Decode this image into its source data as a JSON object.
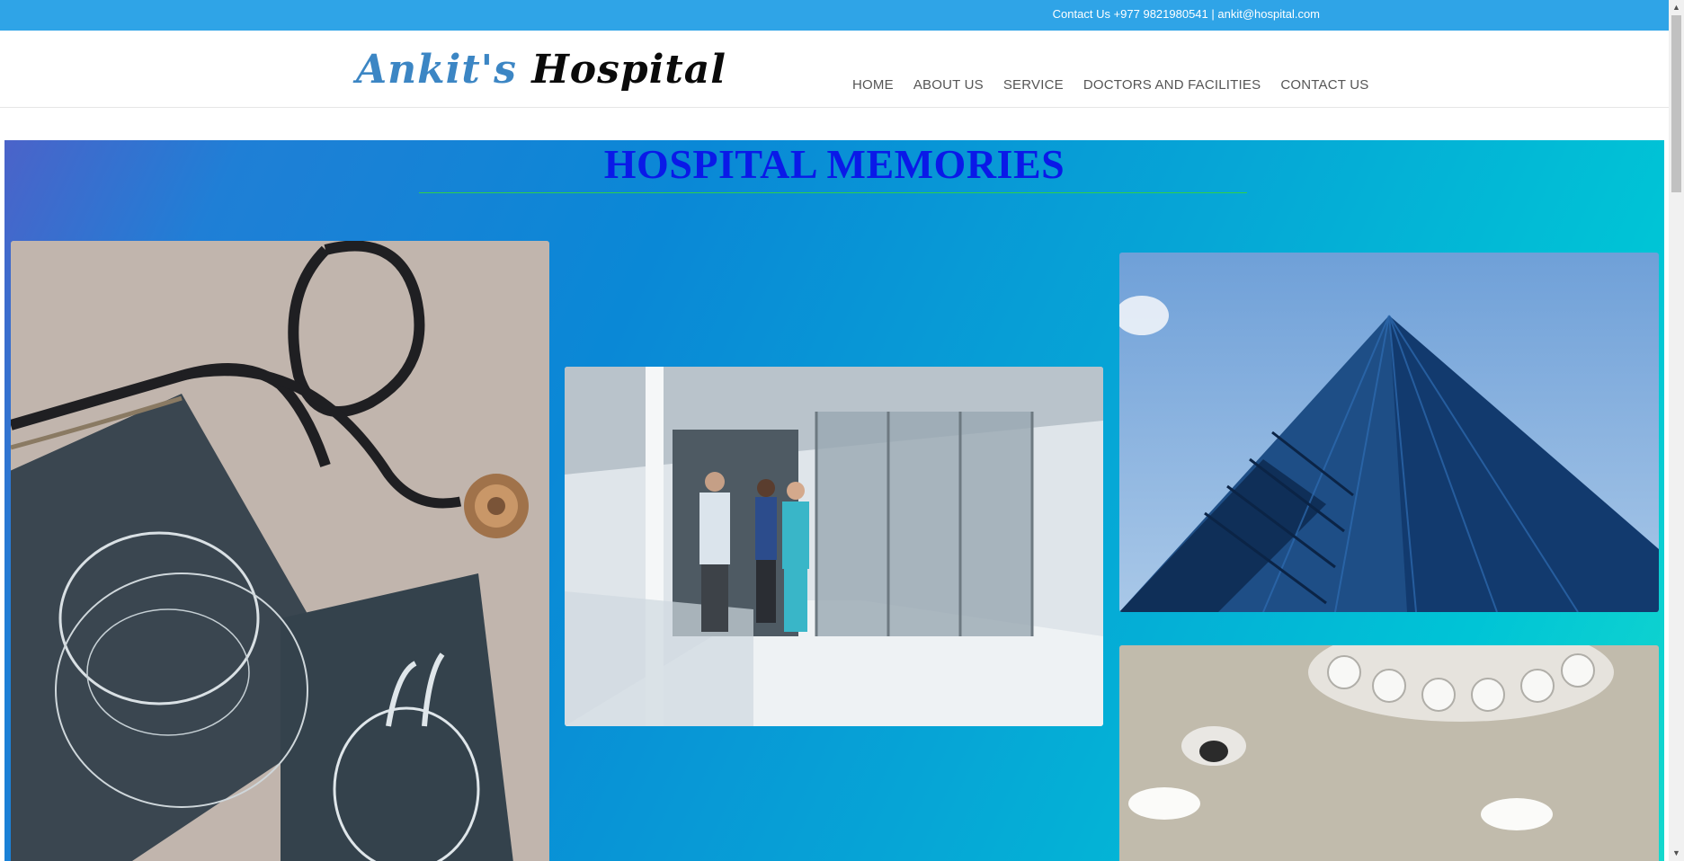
{
  "topbar": {
    "contact": "Contact Us +977 9821980541 | ankit@hospital.com"
  },
  "logo": {
    "part1": "Ankit's",
    "part2": "Hospital"
  },
  "nav": {
    "items": [
      "HOME",
      "ABOUT US",
      "SERVICE",
      "DOCTORS AND FACILITIES",
      "CONTACT US"
    ]
  },
  "gallery": {
    "title": "HOSPITAL MEMORIES",
    "photos": [
      "stethoscope-anatomy-photo",
      "hospital-corridor-staff-photo",
      "glass-building-photo",
      "operating-room-lights-photo"
    ]
  },
  "colors": {
    "topbar": "#2fa4e7",
    "title": "#0a19e8",
    "logo_accent": "#3c86c4",
    "underline": "#2fd04a"
  }
}
